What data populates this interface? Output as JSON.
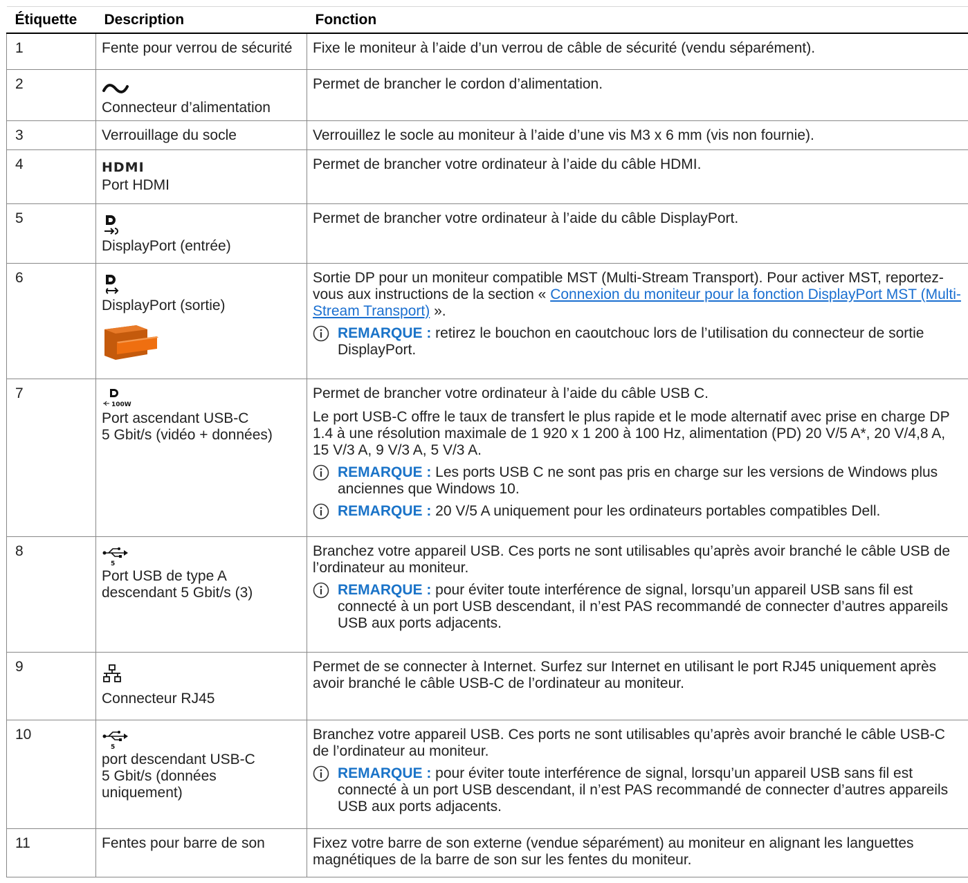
{
  "headers": [
    "Étiquette",
    "Description",
    "Fonction"
  ],
  "rows": [
    {
      "label": "1",
      "desc": "Fente pour verrou de sécurité",
      "func": "Fixe le moniteur à l’aide d’un verrou de câble de sécurité (vendu séparément)."
    },
    {
      "label": "2",
      "icon": "ac-power-icon",
      "desc": "Connecteur d’alimentation",
      "func": "Permet de brancher le cordon d’alimentation."
    },
    {
      "label": "3",
      "desc": "Verrouillage du socle",
      "func": "Verrouillez le socle au moniteur à l’aide d’une vis M3 x 6 mm (vis non fournie)."
    },
    {
      "label": "4",
      "icon": "hdmi-icon",
      "desc": "Port HDMI",
      "func": "Permet de brancher votre ordinateur à l’aide du câble HDMI."
    },
    {
      "label": "5",
      "icon": "displayport-in-icon",
      "desc": "DisplayPort (entrée)",
      "func": "Permet de brancher votre ordinateur à l’aide du câble DisplayPort."
    },
    {
      "label": "6",
      "icon": "displayport-out-icon",
      "desc": "DisplayPort (sortie)",
      "func_before": "Sortie DP pour un moniteur compatible MST (Multi-Stream Transport). Pour activer MST, reportez-vous aux instructions de la section « ",
      "func_link": "Connexion du moniteur pour la fonction DisplayPort MST (Multi-Stream Transport)",
      "func_after": " ».",
      "note": {
        "label": "REMARQUE :",
        "text": " retirez le bouchon en caoutchouc lors de l’utilisation du connecteur de sortie DisplayPort."
      }
    },
    {
      "label": "7",
      "icon": "usb-c-dp-100w-icon",
      "desc": "Port ascendant USB-C\n5 Gbit/s (vidéo + données)",
      "func": "Permet de brancher votre ordinateur à l’aide du câble USB C.",
      "func2": "Le port USB-C offre le taux de transfert le plus rapide et le mode alternatif avec prise en charge DP 1.4 à une résolution maximale de 1 920 x 1 200 à 100 Hz, alimentation (PD) 20 V/5 A*, 20 V/4,8 A, 15 V/3 A, 9 V/3 A, 5 V/3 A.",
      "note1": {
        "label": "REMARQUE :",
        "text": " Les ports USB C ne sont pas pris en charge sur les versions de Windows plus anciennes que Windows 10."
      },
      "note2": {
        "label": "REMARQUE :",
        "text": " 20 V/5 A uniquement pour les ordinateurs portables compatibles Dell."
      }
    },
    {
      "label": "8",
      "icon": "usb-5-icon",
      "desc": "Port USB de type A\ndescendant 5 Gbit/s (3)",
      "func": "Branchez votre appareil USB. Ces ports ne sont utilisables qu’après avoir branché le câble USB de l’ordinateur au moniteur.",
      "note": {
        "label": "REMARQUE :",
        "text": " pour éviter toute interférence de signal, lorsqu’un appareil USB sans fil est connecté à un port USB descendant, il n’est PAS recommandé de connecter d’autres appareils USB aux ports adjacents."
      }
    },
    {
      "label": "9",
      "icon": "network-icon",
      "desc": "Connecteur RJ45",
      "func": "Permet de se connecter à Internet. Surfez sur Internet en utilisant le port RJ45 uniquement après avoir branché le câble USB-C de l’ordinateur au moniteur."
    },
    {
      "label": "10",
      "icon": "usb-5-icon",
      "desc": "port descendant USB-C\n5 Gbit/s (données\nuniquement)",
      "func": "Branchez votre appareil USB. Ces ports ne sont utilisables qu’après avoir branché le câble USB-C de l’ordinateur au moniteur.",
      "note": {
        "label": "REMARQUE :",
        "text": " pour éviter toute interférence de signal, lorsqu’un appareil USB sans fil est connecté à un port USB descendant, il n’est PAS recommandé de connecter d’autres appareils USB aux ports adjacents."
      }
    },
    {
      "label": "11",
      "desc": "Fentes pour barre de son",
      "func": "Fixez votre barre de son externe (vendue séparément) au moniteur en alignant les languettes magnétiques de la barre de son sur les fentes du moniteur."
    }
  ],
  "icon_texts": {
    "hdmi": "HDMI",
    "usb_speed": "5",
    "dp_power": "100W"
  },
  "colors": {
    "note_label": "#1a73c8",
    "link": "#1a6fd0",
    "plug": "#e36a12"
  }
}
